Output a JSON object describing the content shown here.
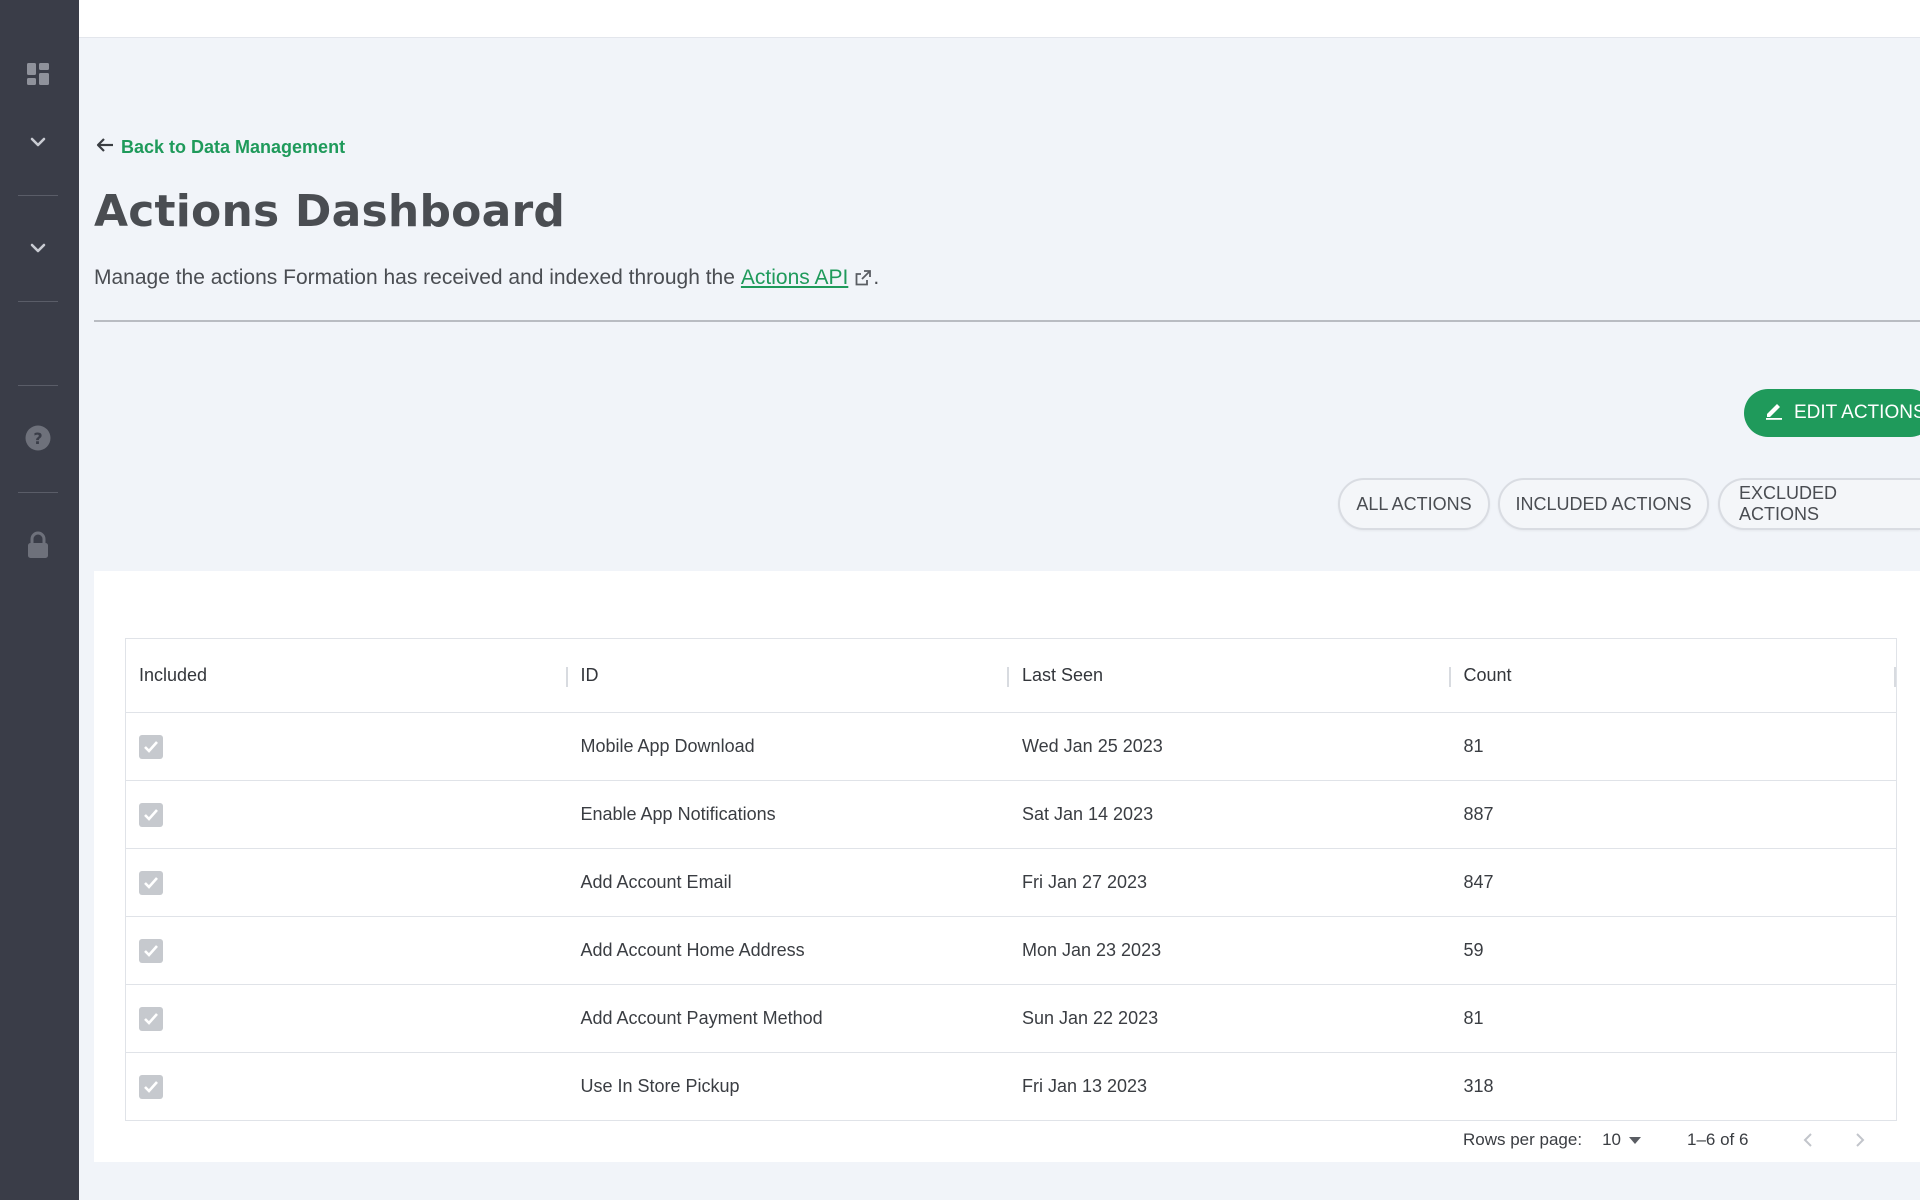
{
  "sidebar": {
    "icons": [
      "dashboard-icon",
      "chevron-down-icon",
      "chevron-down-icon",
      "help-icon",
      "lock-icon"
    ]
  },
  "back_link": {
    "label": "Back to Data Management"
  },
  "page": {
    "title": "Actions Dashboard",
    "description_prefix": "Manage the actions Formation has received and indexed through the",
    "api_link_label": "Actions API",
    "description_suffix": "."
  },
  "toolbar": {
    "edit_label": "EDIT ACTIONS"
  },
  "filters": [
    {
      "label": "ALL ACTIONS"
    },
    {
      "label": "INCLUDED ACTIONS"
    },
    {
      "label": "EXCLUDED ACTIONS"
    }
  ],
  "table": {
    "columns": [
      "Included",
      "ID",
      "Last Seen",
      "Count"
    ],
    "rows": [
      {
        "included": true,
        "id": "Mobile App Download",
        "last_seen": "Wed Jan 25 2023",
        "count": "81"
      },
      {
        "included": true,
        "id": "Enable App Notifications",
        "last_seen": "Sat Jan 14 2023",
        "count": "887"
      },
      {
        "included": true,
        "id": "Add Account Email",
        "last_seen": "Fri Jan 27 2023",
        "count": "847"
      },
      {
        "included": true,
        "id": "Add Account Home Address",
        "last_seen": "Mon Jan 23 2023",
        "count": "59"
      },
      {
        "included": true,
        "id": "Add Account Payment Method",
        "last_seen": "Sun Jan 22 2023",
        "count": "81"
      },
      {
        "included": true,
        "id": "Use In Store Pickup",
        "last_seen": "Fri Jan 13 2023",
        "count": "318"
      }
    ]
  },
  "pagination": {
    "rows_per_page_label": "Rows per page:",
    "rows_per_page_value": "10",
    "range": "1–6 of 6"
  },
  "colors": {
    "accent": "#1f9a5b",
    "sidebar": "#3a3d48",
    "background": "#f1f4f9"
  }
}
